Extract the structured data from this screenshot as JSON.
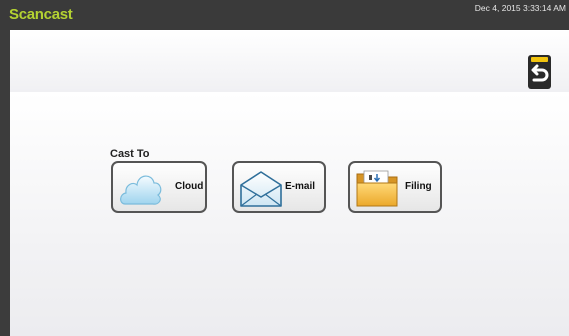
{
  "app": {
    "title": "Scancast",
    "datetime": "Dec 4, 2015 3:33:14 AM"
  },
  "section": {
    "label": "Cast To"
  },
  "actions": [
    {
      "label": "Cloud",
      "icon": "cloud-icon"
    },
    {
      "label": "E-mail",
      "icon": "envelope-icon"
    },
    {
      "label": "Filing",
      "icon": "folder-icon"
    }
  ],
  "colors": {
    "brand": "#b4d232",
    "titlebar": "#3a3a3a",
    "back_button_accent": "#f2c40f"
  }
}
